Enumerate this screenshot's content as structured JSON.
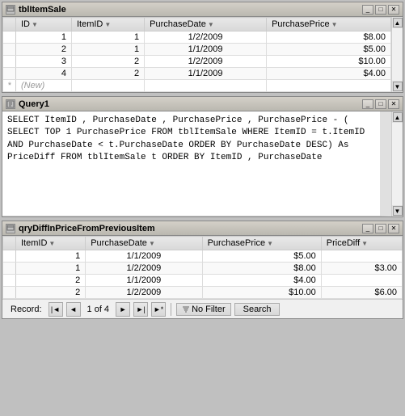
{
  "windows": {
    "tblItemSale": {
      "title": "tblItemSale",
      "columns": [
        "ID",
        "ItemID",
        "PurchaseDate",
        "PurchasePrice"
      ],
      "rows": [
        {
          "id": "1",
          "itemid": "1",
          "purchasedate": "1/2/2009",
          "purchaseprice": "$8.00"
        },
        {
          "id": "2",
          "itemid": "1",
          "purchasedate": "1/1/2009",
          "purchaseprice": "$5.00"
        },
        {
          "id": "3",
          "itemid": "2",
          "purchasedate": "1/2/2009",
          "purchaseprice": "$10.00"
        },
        {
          "id": "4",
          "itemid": "2",
          "purchasedate": "1/1/2009",
          "purchaseprice": "$4.00"
        }
      ],
      "new_row_label": "(New)"
    },
    "query1": {
      "title": "Query1",
      "sql": "SELECT\n  ItemID\n , PurchaseDate\n , PurchasePrice\n , PurchasePrice -\n  ( SELECT TOP 1 PurchasePrice FROM tblItemSale WHERE ItemID = t.ItemID\n    AND PurchaseDate < t.PurchaseDate ORDER BY PurchaseDate DESC) As PriceDiff\nFROM\n  tblItemSale t\nORDER BY\n  ItemID\n , PurchaseDate"
    },
    "qryDiffInPriceFromPreviousItem": {
      "title": "qryDiffInPriceFromPreviousItem",
      "columns": [
        "ItemID",
        "PurchaseDate",
        "PurchasePrice",
        "PriceDiff"
      ],
      "rows": [
        {
          "itemid": "1",
          "purchasedate": "1/1/2009",
          "purchaseprice": "$5.00",
          "pricediff": ""
        },
        {
          "itemid": "1",
          "purchasedate": "1/2/2009",
          "purchaseprice": "$8.00",
          "pricediff": "$3.00"
        },
        {
          "itemid": "2",
          "purchasedate": "1/1/2009",
          "purchaseprice": "$4.00",
          "pricediff": ""
        },
        {
          "itemid": "2",
          "purchasedate": "1/2/2009",
          "purchaseprice": "$10.00",
          "pricediff": "$6.00"
        }
      ],
      "statusbar": {
        "record_label": "Record:",
        "record_nav_first": "◄◄",
        "record_nav_prev": "◄",
        "record_position": "1 of 4",
        "record_nav_next": "►",
        "record_nav_last": "►►",
        "record_nav_new": "►◄",
        "no_filter_label": "No Filter",
        "search_label": "Search"
      }
    }
  },
  "window_controls": {
    "minimize": "_",
    "restore": "□",
    "close": "✕"
  }
}
